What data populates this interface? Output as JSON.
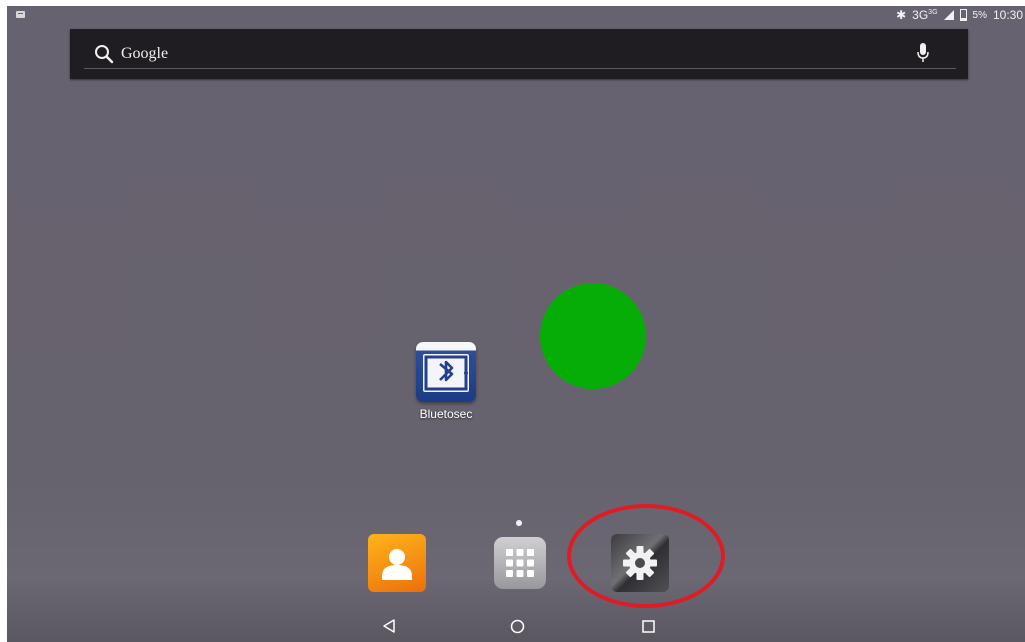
{
  "status_bar": {
    "bluetooth_icon": "bluetooth-icon",
    "network": "3G",
    "network_sup": "3G",
    "battery": "5%",
    "time": "10:30"
  },
  "search": {
    "label": "Google",
    "search_icon": "search-icon",
    "mic_icon": "mic-icon"
  },
  "desktop": {
    "apps": [
      {
        "label": "Bluetosec",
        "icon": "bluetooth-app-icon"
      }
    ],
    "widget_color": "#06ad07"
  },
  "dock": {
    "items": [
      {
        "icon": "contacts-icon"
      },
      {
        "icon": "app-drawer-icon"
      },
      {
        "icon": "settings-icon"
      }
    ],
    "highlight_color": "#e01b24"
  },
  "nav": {
    "back_icon": "back-icon",
    "home_icon": "home-icon",
    "recents_icon": "recents-icon"
  }
}
